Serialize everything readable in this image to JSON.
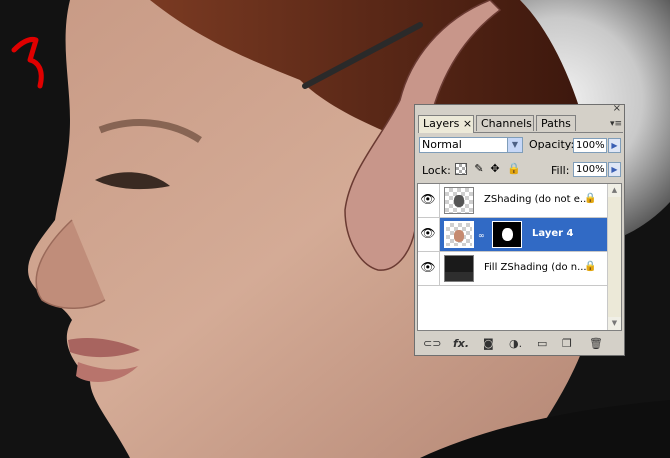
{
  "panel": {
    "tabs": [
      {
        "label": "Layers ×",
        "active": true
      },
      {
        "label": "Channels",
        "active": false
      },
      {
        "label": "Paths",
        "active": false
      }
    ],
    "blend_mode": "Normal",
    "opacity_label": "Opacity:",
    "opacity_value": "100%",
    "lock_label": "Lock:",
    "fill_label": "Fill:",
    "fill_value": "100%",
    "close_glyph": "×",
    "menu_glyph": "▾≡",
    "layers": [
      {
        "name": "ZShading (do not e...",
        "visible": true,
        "selected": false,
        "locked": true
      },
      {
        "name": "Layer 4",
        "visible": true,
        "selected": true,
        "locked": false
      },
      {
        "name": "Fill ZShading (do n...",
        "visible": true,
        "selected": false,
        "locked": true
      }
    ],
    "icons": {
      "eye": "eye-icon",
      "lock": "lock-icon",
      "link": "link-icon",
      "fx": "fx-icon",
      "mask": "mask-icon",
      "adjustment": "adjustment-icon",
      "group": "folder-icon",
      "new_layer": "new-layer-icon",
      "trash": "trash-icon"
    },
    "bottom_glyphs": {
      "link": "⊂⊃",
      "fx": "fx.",
      "mask": "◙",
      "adjustment": "◑.",
      "group": "▭",
      "new": "❐",
      "trash": "🗑"
    }
  },
  "colors": {
    "selection": "#316ac5",
    "panel_bg": "#d4d0c8",
    "annotation": "#e00000"
  }
}
